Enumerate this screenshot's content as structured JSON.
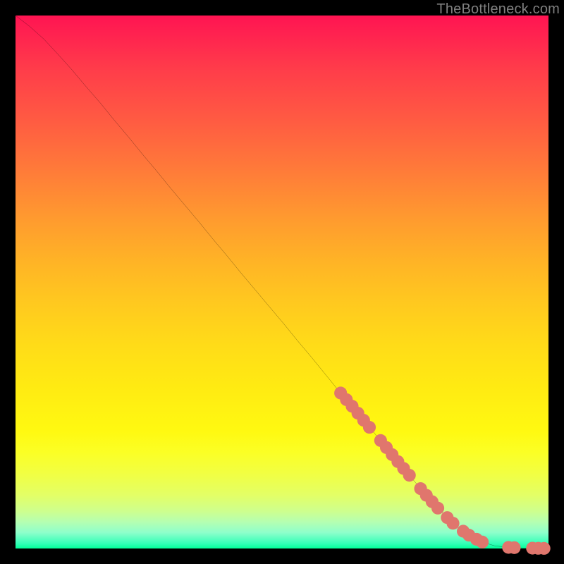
{
  "watermark": "TheBottleneck.com",
  "chart_data": {
    "type": "line",
    "title": "",
    "xlabel": "",
    "ylabel": "",
    "xlim": [
      0,
      100
    ],
    "ylim": [
      0,
      100
    ],
    "grid": false,
    "series": [
      {
        "name": "curve",
        "stroke": "#000000",
        "x": [
          0.0,
          2.6,
          5.3,
          7.9,
          10.6,
          13.2,
          15.9,
          18.5,
          21.2,
          23.8,
          26.5,
          29.1,
          31.7,
          34.4,
          37.0,
          39.7,
          42.3,
          45.0,
          47.6,
          50.3,
          52.9,
          55.6,
          58.2,
          60.8,
          63.5,
          66.1,
          68.8,
          71.4,
          74.1,
          76.7,
          79.4,
          82.0,
          84.7,
          87.3,
          89.9,
          92.6,
          95.2,
          100.0
        ],
        "y": [
          100.0,
          98.0,
          95.6,
          92.8,
          89.8,
          86.7,
          83.6,
          80.4,
          77.2,
          74.0,
          70.8,
          67.6,
          64.5,
          61.3,
          58.1,
          54.9,
          51.7,
          48.5,
          45.4,
          42.2,
          39.0,
          35.8,
          32.6,
          29.4,
          26.3,
          23.1,
          19.9,
          16.7,
          13.5,
          10.4,
          7.4,
          4.8,
          2.7,
          1.3,
          0.5,
          0.2,
          0.1,
          0.0
        ]
      }
    ],
    "marker_clusters": {
      "color": "#e0766d",
      "radius": 1.2,
      "clusters": [
        {
          "x_start": 61.0,
          "x_end": 67.0
        },
        {
          "x_start": 68.5,
          "x_end": 74.0
        },
        {
          "x_start": 76.0,
          "x_end": 80.0
        },
        {
          "x_start": 81.0,
          "x_end": 83.0
        },
        {
          "x_start": 84.0,
          "x_end": 85.5
        },
        {
          "x_start": 86.5,
          "x_end": 88.0
        },
        {
          "x_start": 92.5,
          "x_end": 94.0
        },
        {
          "x_start": 97.0,
          "x_end": 100.0
        }
      ]
    }
  }
}
